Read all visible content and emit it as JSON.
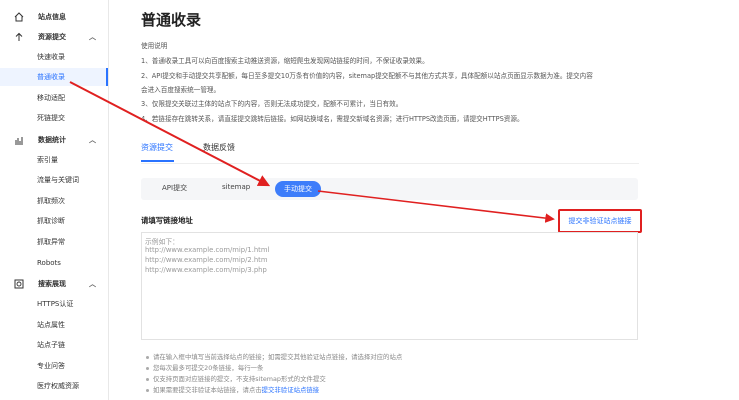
{
  "sidebar": {
    "site_info": "站点信息",
    "resource_submit": "资源提交",
    "quick_index": "快速收录",
    "normal_index": "普通收录",
    "mobile_adapt": "移动适配",
    "dead_link": "死链提交",
    "data_stats": "数据统计",
    "index_volume": "索引量",
    "traffic_keywords": "流量与关键词",
    "crawl_frequency": "抓取频次",
    "crawl_diagnose": "抓取诊断",
    "crawl_error": "抓取异常",
    "robots": "Robots",
    "search_display": "搜索展现",
    "https_auth": "HTTPS认证",
    "site_attributes": "站点属性",
    "site_sublinks": "站点子链",
    "professional_qa": "专业问答",
    "medical_resources": "医疗权威资源"
  },
  "main": {
    "title": "普通收录",
    "desc_header": "使用说明",
    "desc": [
      "1、普通收录工具可以向百度搜索主动推送资源，缩短爬虫发现网站链接的时间，不保证收录效果。",
      "2、API提交和手动提交共享配额，每日至多提交10万条有价值的内容，sitemap提交配额不与其他方式共享，具体配额以站点页面显示数据为准。提交内容",
      "会进入百度搜索统一管理。",
      "3、仅限提交关联过主体的站点下的内容，否则无法成功提交，配额不可累计，当日有效。",
      "4、若链接存在跳转关系，请直接提交跳转后链接。如网站换域名，需提交新域名资源；进行HTTPS改造页面，请提交HTTPS资源。"
    ],
    "tabs": [
      "资源提交",
      "数据反馈"
    ],
    "sub_tabs": [
      "API提交",
      "sitemap",
      "手动提交"
    ],
    "section_label": "请填写链接地址",
    "verify_link": "提交非验证站点链接",
    "textarea_lines": [
      "示例如下：",
      "http://www.example.com/mip/1.html",
      "http://www.example.com/mip/2.htm",
      "http://www.example.com/mip/3.php"
    ],
    "tips": [
      "请在输入框中填写当前选择站点的链接；如需提交其他验证站点链接，请选择对应的站点",
      "您每次最多可提交20条链接，每行一条",
      "仅支持页面对应链接的提交，不支持sitemap形式的文件提交",
      "如果需要提交非验证本站链接，请点击"
    ],
    "tip_link": "提交非验证站点链接"
  },
  "colors": {
    "accent": "#2a73ff",
    "annotation": "#e02020"
  }
}
